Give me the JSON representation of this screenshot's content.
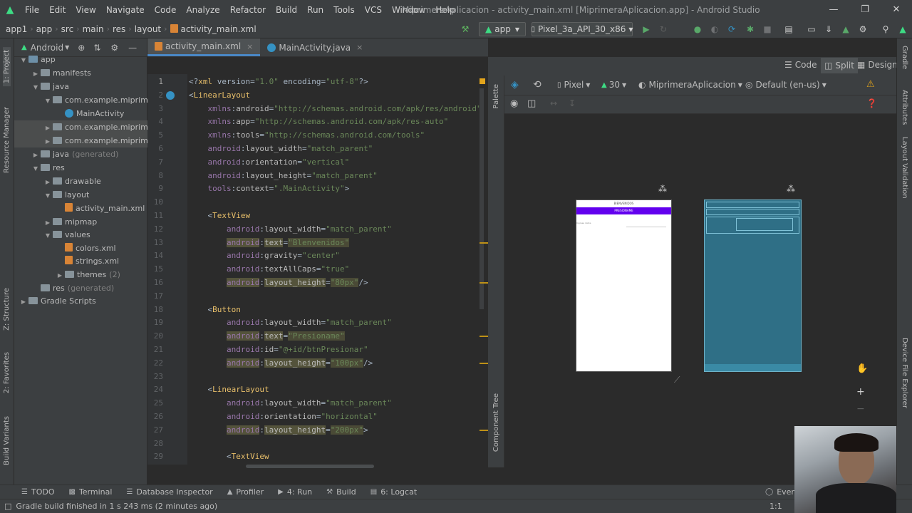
{
  "app": {
    "menu": [
      "File",
      "Edit",
      "View",
      "Navigate",
      "Code",
      "Analyze",
      "Refactor",
      "Build",
      "Run",
      "Tools",
      "VCS",
      "Window",
      "Help"
    ],
    "window_title": "MiprimeraAplicacion - activity_main.xml [MiprimeraAplicacion.app] - Android Studio",
    "window_controls": [
      "—",
      "❐",
      "✕"
    ]
  },
  "navbar": {
    "breadcrumbs": [
      "app1",
      "app",
      "src",
      "main",
      "res",
      "layout",
      "activity_main.xml"
    ],
    "run_config": "app",
    "device": "Pixel_3a_API_30_x86"
  },
  "project_panel": {
    "view_mode": "Android",
    "tree": [
      {
        "label": "app",
        "depth": 0,
        "open": true,
        "icon": "folder"
      },
      {
        "label": "manifests",
        "depth": 1,
        "open": false,
        "icon": "folder"
      },
      {
        "label": "java",
        "depth": 1,
        "open": true,
        "icon": "folder"
      },
      {
        "label": "com.example.miprimer",
        "depth": 2,
        "open": true,
        "icon": "folder"
      },
      {
        "label": "MainActivity",
        "depth": 3,
        "open": null,
        "icon": "class"
      },
      {
        "label": "com.example.miprimer",
        "depth": 2,
        "open": false,
        "icon": "folder",
        "suffix": ""
      },
      {
        "label": "com.example.miprimer",
        "depth": 2,
        "open": false,
        "icon": "folder",
        "suffix": ""
      },
      {
        "label": "java",
        "depth": 1,
        "open": false,
        "icon": "folder",
        "suffix": "(generated)"
      },
      {
        "label": "res",
        "depth": 1,
        "open": true,
        "icon": "folder"
      },
      {
        "label": "drawable",
        "depth": 2,
        "open": false,
        "icon": "folder"
      },
      {
        "label": "layout",
        "depth": 2,
        "open": true,
        "icon": "folder"
      },
      {
        "label": "activity_main.xml",
        "depth": 3,
        "open": null,
        "icon": "xml"
      },
      {
        "label": "mipmap",
        "depth": 2,
        "open": false,
        "icon": "folder"
      },
      {
        "label": "values",
        "depth": 2,
        "open": true,
        "icon": "folder"
      },
      {
        "label": "colors.xml",
        "depth": 3,
        "open": null,
        "icon": "xml"
      },
      {
        "label": "strings.xml",
        "depth": 3,
        "open": null,
        "icon": "xml"
      },
      {
        "label": "themes",
        "depth": 3,
        "open": false,
        "icon": "folder",
        "suffix": "(2)"
      },
      {
        "label": "res",
        "depth": 1,
        "open": null,
        "icon": "folder",
        "suffix": "(generated)"
      },
      {
        "label": "Gradle Scripts",
        "depth": 0,
        "open": false,
        "icon": "gradle"
      }
    ]
  },
  "left_strip": [
    "1: Project",
    "Resource Manager",
    "Z: Structure",
    "2: Favorites",
    "Build Variants"
  ],
  "right_strip": [
    "Gradle",
    "Attributes",
    "Layout Validation",
    "Device File Explorer"
  ],
  "editor_tabs": [
    {
      "label": "activity_main.xml",
      "active": true
    },
    {
      "label": "MainActivity.java",
      "active": false
    }
  ],
  "code_lines": [
    "<?xml version=\"1.0\" encoding=\"utf-8\"?>",
    "<LinearLayout",
    "    xmlns:android=\"http://schemas.android.com/apk/res/android\"",
    "    xmlns:app=\"http://schemas.android.com/apk/res-auto\"",
    "    xmlns:tools=\"http://schemas.android.com/tools\"",
    "    android:layout_width=\"match_parent\"",
    "    android:orientation=\"vertical\"",
    "    android:layout_height=\"match_parent\"",
    "    tools:context=\".MainActivity\">",
    "",
    "    <TextView",
    "        android:layout_width=\"match_parent\"",
    "        android:text=\"Blenvenidos\"",
    "        android:gravity=\"center\"",
    "        android:textAllCaps=\"true\"",
    "        android:layout_height=\"80px\"/>",
    "",
    "    <Button",
    "        android:layout_width=\"match_parent\"",
    "        android:text=\"Presioname\"",
    "        android:id=\"@+id/btnPresionar\"",
    "        android:layout_height=\"100px\"/>",
    "",
    "    <LinearLayout",
    "        android:layout_width=\"match_parent\"",
    "        android:orientation=\"horizontal\"",
    "        android:layout_height=\"200px\">",
    "",
    "        <TextView"
  ],
  "design": {
    "modes": [
      "Code",
      "Split",
      "Design"
    ],
    "active_mode": "Split",
    "device": "Pixel",
    "api": "30",
    "theme": "MiprimeraAplicacion",
    "locale": "Default (en-us)",
    "preview_title": "BIENVENIDOS",
    "preview_button": "PRESIONAME",
    "preview_hint": "Ingresa datos",
    "palette_label": "Palette",
    "component_tree_label": "Component Tree"
  },
  "bottom_tools": [
    "TODO",
    "Terminal",
    "Database Inspector",
    "Profiler",
    "4: Run",
    "Build",
    "6: Logcat",
    "Event"
  ],
  "status": {
    "message": "Gradle build finished in 1 s 243 ms (2 minutes ago)",
    "position": "1:1"
  },
  "colors": {
    "accent": "#4a88c7",
    "android_green": "#3ddc84",
    "preview_purple": "#6200ee",
    "blueprint": "#2f6f86"
  }
}
